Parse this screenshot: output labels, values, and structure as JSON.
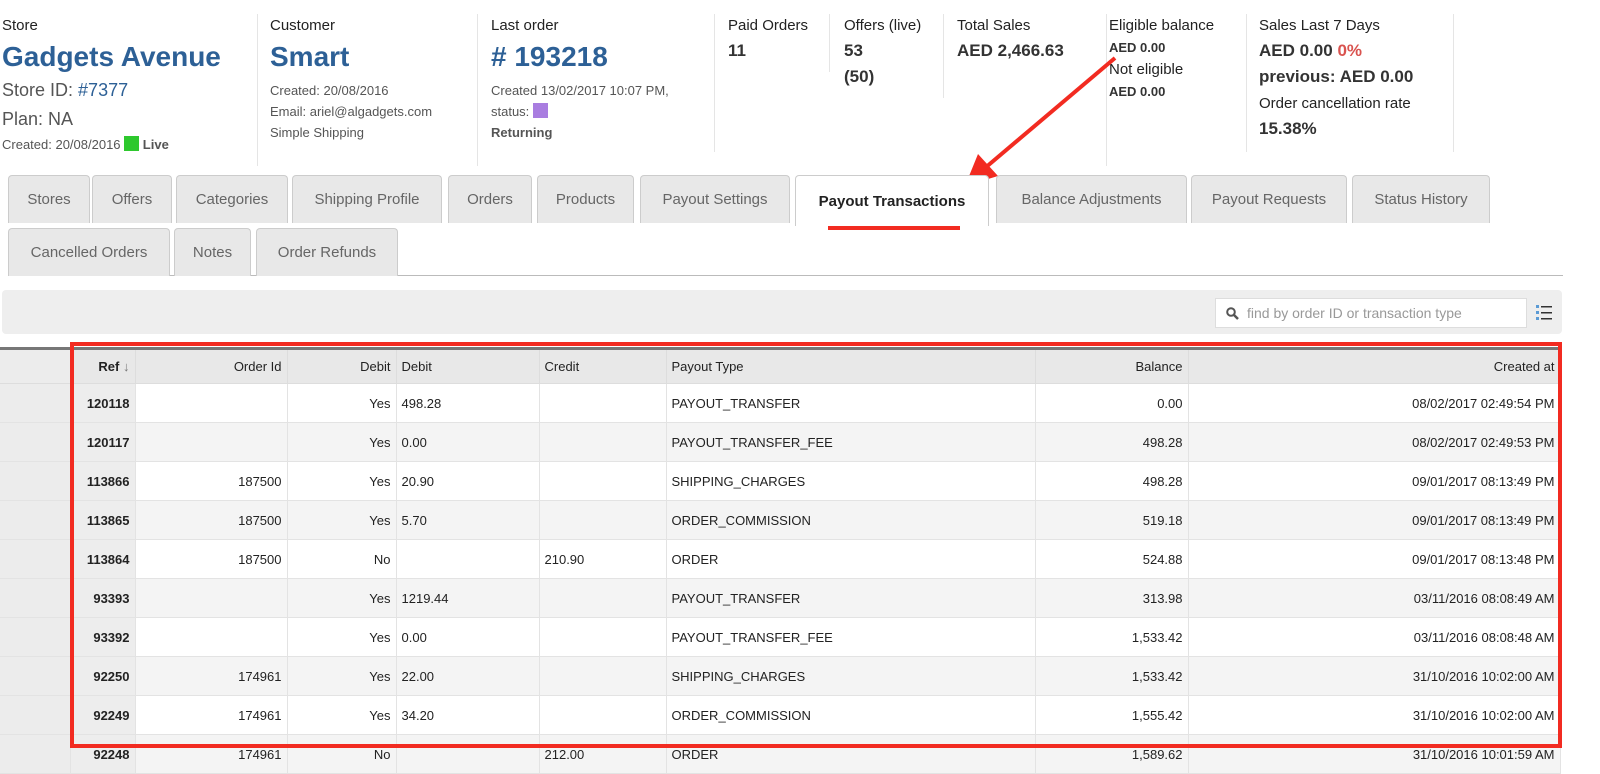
{
  "store": {
    "label": "Store",
    "name": "Gadgets Avenue",
    "id_label": "Store ID:",
    "id": "#7377",
    "plan": "Plan: NA",
    "created": "Created: 20/08/2016",
    "status": "Live",
    "status_color": "#2ec82e"
  },
  "customer": {
    "label": "Customer",
    "name": "Smart",
    "created": "Created: 20/08/2016",
    "email": "Email: ariel@algadgets.com",
    "shipping": "Simple Shipping"
  },
  "last_order": {
    "label": "Last order",
    "number": "# 193218",
    "created": "Created 13/02/2017 10:07 PM,",
    "status_label": "status:",
    "status_color": "#a97de0",
    "type": "Returning"
  },
  "stats": {
    "paid_orders": {
      "label": "Paid Orders",
      "value": "11"
    },
    "offers": {
      "label": "Offers (live)",
      "value": "53",
      "live": "(50)"
    },
    "total_sales": {
      "label": "Total Sales",
      "value": "AED 2,466.63"
    },
    "eligible": {
      "label": "Eligible balance",
      "value": "AED 0.00",
      "not_label": "Not eligible",
      "not_value": "AED 0.00"
    },
    "sales7": {
      "label": "Sales Last 7 Days",
      "value": "AED 0.00",
      "pct": "0%",
      "previous": "previous: AED 0.00",
      "cancel_label": "Order cancellation rate",
      "cancel_value": "15.38%"
    }
  },
  "tabs_row1": [
    "Stores",
    "Offers",
    "Categories",
    "Shipping Profile",
    "Orders",
    "Products",
    "Payout Settings",
    "Payout Transactions",
    "Balance Adjustments",
    "Payout Requests",
    "Status History"
  ],
  "tabs_row2": [
    "Cancelled Orders",
    "Notes",
    "Order Refunds"
  ],
  "active_tab": "Payout Transactions",
  "search": {
    "placeholder": "find by order ID or transaction type"
  },
  "table": {
    "columns": [
      "Ref",
      "Order Id",
      "Debit",
      "Debit",
      "Credit",
      "Payout Type",
      "Balance",
      "Created at"
    ],
    "sort": "Ref descending",
    "rows": [
      [
        "120118",
        "",
        "Yes",
        "498.28",
        "",
        "PAYOUT_TRANSFER",
        "0.00",
        "08/02/2017 02:49:54 PM"
      ],
      [
        "120117",
        "",
        "Yes",
        "0.00",
        "",
        "PAYOUT_TRANSFER_FEE",
        "498.28",
        "08/02/2017 02:49:53 PM"
      ],
      [
        "113866",
        "187500",
        "Yes",
        "20.90",
        "",
        "SHIPPING_CHARGES",
        "498.28",
        "09/01/2017 08:13:49 PM"
      ],
      [
        "113865",
        "187500",
        "Yes",
        "5.70",
        "",
        "ORDER_COMMISSION",
        "519.18",
        "09/01/2017 08:13:49 PM"
      ],
      [
        "113864",
        "187500",
        "No",
        "",
        "210.90",
        "ORDER",
        "524.88",
        "09/01/2017 08:13:48 PM"
      ],
      [
        "93393",
        "",
        "Yes",
        "1219.44",
        "",
        "PAYOUT_TRANSFER",
        "313.98",
        "03/11/2016 08:08:49 AM"
      ],
      [
        "93392",
        "",
        "Yes",
        "0.00",
        "",
        "PAYOUT_TRANSFER_FEE",
        "1,533.42",
        "03/11/2016 08:08:48 AM"
      ],
      [
        "92250",
        "174961",
        "Yes",
        "22.00",
        "",
        "SHIPPING_CHARGES",
        "1,533.42",
        "31/10/2016 10:02:00 AM"
      ],
      [
        "92249",
        "174961",
        "Yes",
        "34.20",
        "",
        "ORDER_COMMISSION",
        "1,555.42",
        "31/10/2016 10:02:00 AM"
      ],
      [
        "92248",
        "174961",
        "No",
        "",
        "212.00",
        "ORDER",
        "1,589.62",
        "31/10/2016 10:01:59 AM"
      ]
    ]
  },
  "annotation_color": "#f22b21"
}
